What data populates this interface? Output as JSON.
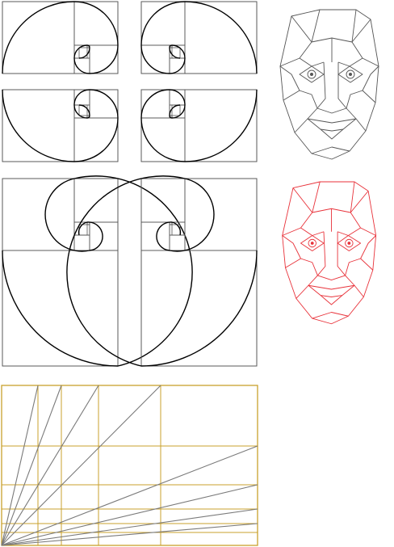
{
  "page": {
    "background": "#ffffff"
  },
  "spirals": {
    "count": 6,
    "frame_color": "#555555",
    "spiral_color": "#000000",
    "variants": [
      "top-left-a",
      "top-right-a",
      "top-left-b",
      "top-right-b",
      "tall-left",
      "tall-right"
    ]
  },
  "faces": {
    "top": {
      "color": "#555555",
      "label": "golden-ratio-face-mask-gray"
    },
    "bottom": {
      "color": "#e8323a",
      "label": "golden-ratio-face-mask-red"
    }
  },
  "golden_grid": {
    "line_color": "#c8a02c",
    "ray_color": "#7a7a7a"
  }
}
